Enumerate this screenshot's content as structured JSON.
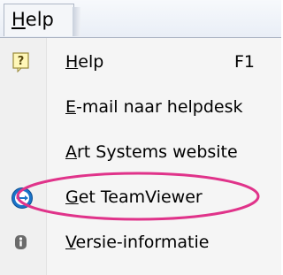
{
  "menubar": {
    "help_menu_mnemonic": "H",
    "help_menu_rest": "elp"
  },
  "menu": {
    "items": [
      {
        "mnemonic": "H",
        "rest": "elp",
        "shortcut": "F1",
        "icon": "help-question-icon"
      },
      {
        "mnemonic": "E",
        "rest": "-mail naar helpdesk"
      },
      {
        "mnemonic": "A",
        "rest": "rt Systems website"
      },
      {
        "mnemonic": "G",
        "rest": "et TeamViewer",
        "icon": "teamviewer-icon",
        "highlighted": true
      },
      {
        "mnemonic": "V",
        "rest": "ersie-informatie",
        "icon": "info-icon"
      }
    ]
  },
  "colors": {
    "highlight_circle": "#e0338a",
    "teamviewer_blue": "#1a73c9"
  }
}
